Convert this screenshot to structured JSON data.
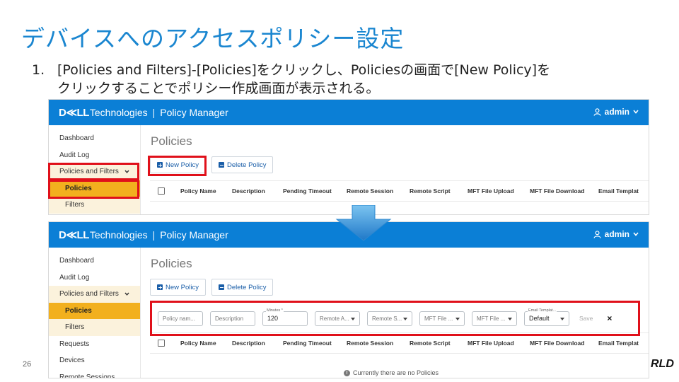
{
  "slide": {
    "title": "デバイスへのアクセスポリシー設定",
    "step_number": "1.",
    "step_line1": "[Policies and Filters]-[Policies]をクリックし、Policiesの画面で[New Policy]を",
    "step_line2": "クリックすることでポリシー作成画面が表示される。",
    "page_number": "26",
    "corner_logo": "RLD"
  },
  "app": {
    "brand_dell": "D≪LL",
    "brand_tech": "Technologies",
    "brand_sep": "|",
    "product": "Policy Manager",
    "user": "admin",
    "page_heading": "Policies",
    "new_policy": "New Policy",
    "delete_policy": "Delete Policy",
    "columns": [
      "Policy Name",
      "Description",
      "Pending Timeout",
      "Remote Session",
      "Remote Script",
      "MFT File Upload",
      "MFT File Download",
      "Email Templat"
    ],
    "sidebar_top": [
      "Dashboard",
      "Audit Log",
      "Policies and Filters",
      "Policies",
      "Filters"
    ],
    "sidebar_bottom": [
      "Dashboard",
      "Audit Log",
      "Policies and Filters",
      "Policies",
      "Filters",
      "Requests",
      "Devices",
      "Remote Sessions"
    ],
    "form": {
      "policy_name_placeholder": "Policy nam...",
      "description_placeholder": "Description",
      "minutes_label": "Minutes *",
      "minutes_value": "120",
      "remote_a": "Remote A...",
      "remote_s": "Remote S...",
      "mft_file_1": "MFT File ...",
      "mft_file_2": "MFT File ...",
      "email_template_label": "Email Templat...",
      "email_template_value": "Default",
      "save": "Save",
      "close": "×"
    },
    "empty_message": "Currently there are no Policies"
  },
  "colors": {
    "title_blue": "#1a86d0",
    "topbar_blue": "#0b7fd6",
    "highlight_red": "#e0101a",
    "selected_orange": "#f2b01e",
    "expand_bg": "#fbf2dc"
  }
}
